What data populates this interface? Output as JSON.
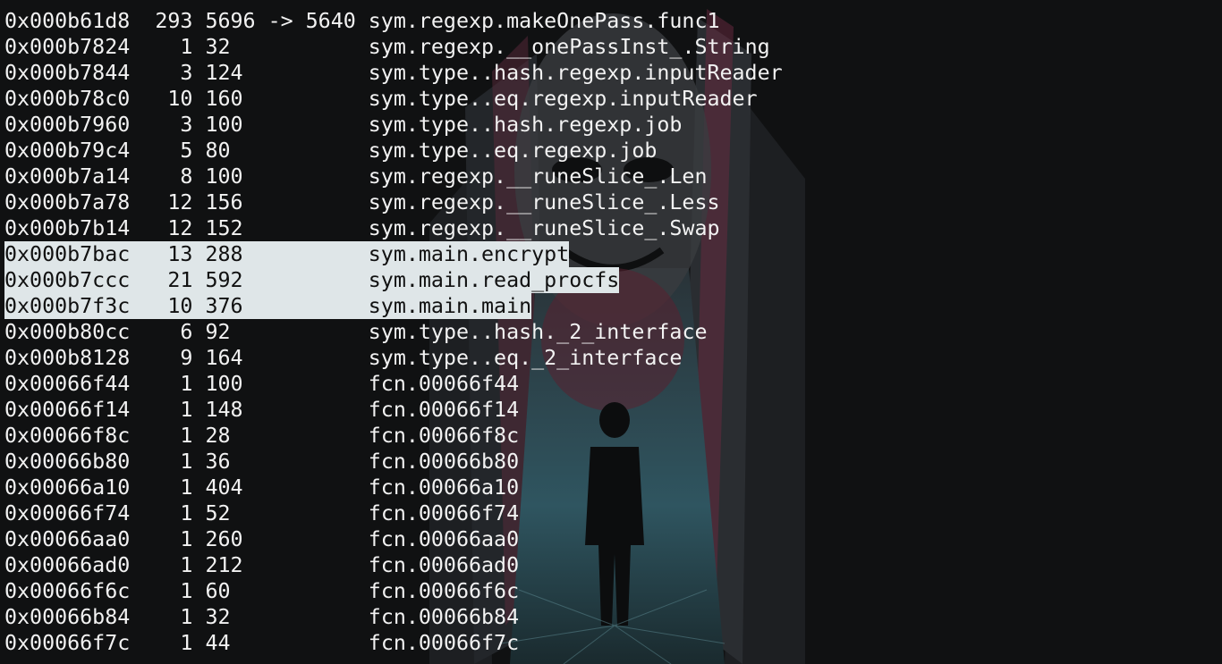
{
  "terminal": {
    "rows": [
      {
        "addr": "0x000b61d8",
        "nbbs": "293",
        "size": "5696 -> 5640",
        "name": "sym.regexp.makeOnePass.func1",
        "selected": false
      },
      {
        "addr": "0x000b7824",
        "nbbs": "1",
        "size": "32",
        "name": "sym.regexp.__onePassInst_.String",
        "selected": false
      },
      {
        "addr": "0x000b7844",
        "nbbs": "3",
        "size": "124",
        "name": "sym.type..hash.regexp.inputReader",
        "selected": false
      },
      {
        "addr": "0x000b78c0",
        "nbbs": "10",
        "size": "160",
        "name": "sym.type..eq.regexp.inputReader",
        "selected": false
      },
      {
        "addr": "0x000b7960",
        "nbbs": "3",
        "size": "100",
        "name": "sym.type..hash.regexp.job",
        "selected": false
      },
      {
        "addr": "0x000b79c4",
        "nbbs": "5",
        "size": "80",
        "name": "sym.type..eq.regexp.job",
        "selected": false
      },
      {
        "addr": "0x000b7a14",
        "nbbs": "8",
        "size": "100",
        "name": "sym.regexp.__runeSlice_.Len",
        "selected": false
      },
      {
        "addr": "0x000b7a78",
        "nbbs": "12",
        "size": "156",
        "name": "sym.regexp.__runeSlice_.Less",
        "selected": false
      },
      {
        "addr": "0x000b7b14",
        "nbbs": "12",
        "size": "152",
        "name": "sym.regexp.__runeSlice_.Swap",
        "selected": false
      },
      {
        "addr": "0x000b7bac",
        "nbbs": "13",
        "size": "288",
        "name": "sym.main.encrypt",
        "selected": true
      },
      {
        "addr": "0x000b7ccc",
        "nbbs": "21",
        "size": "592",
        "name": "sym.main.read_procfs",
        "selected": true
      },
      {
        "addr": "0x000b7f3c",
        "nbbs": "10",
        "size": "376",
        "name": "sym.main.main",
        "selected": true
      },
      {
        "addr": "0x000b80cc",
        "nbbs": "6",
        "size": "92",
        "name": "sym.type..hash._2_interface",
        "selected": false
      },
      {
        "addr": "0x000b8128",
        "nbbs": "9",
        "size": "164",
        "name": "sym.type..eq._2_interface",
        "selected": false
      },
      {
        "addr": "0x00066f44",
        "nbbs": "1",
        "size": "100",
        "name": "fcn.00066f44",
        "selected": false
      },
      {
        "addr": "0x00066f14",
        "nbbs": "1",
        "size": "148",
        "name": "fcn.00066f14",
        "selected": false
      },
      {
        "addr": "0x00066f8c",
        "nbbs": "1",
        "size": "28",
        "name": "fcn.00066f8c",
        "selected": false
      },
      {
        "addr": "0x00066b80",
        "nbbs": "1",
        "size": "36",
        "name": "fcn.00066b80",
        "selected": false
      },
      {
        "addr": "0x00066a10",
        "nbbs": "1",
        "size": "404",
        "name": "fcn.00066a10",
        "selected": false
      },
      {
        "addr": "0x00066f74",
        "nbbs": "1",
        "size": "52",
        "name": "fcn.00066f74",
        "selected": false
      },
      {
        "addr": "0x00066aa0",
        "nbbs": "1",
        "size": "260",
        "name": "fcn.00066aa0",
        "selected": false
      },
      {
        "addr": "0x00066ad0",
        "nbbs": "1",
        "size": "212",
        "name": "fcn.00066ad0",
        "selected": false
      },
      {
        "addr": "0x00066f6c",
        "nbbs": "1",
        "size": "60",
        "name": "fcn.00066f6c",
        "selected": false
      },
      {
        "addr": "0x00066b84",
        "nbbs": "1",
        "size": "32",
        "name": "fcn.00066b84",
        "selected": false
      },
      {
        "addr": "0x00066f7c",
        "nbbs": "1",
        "size": "44",
        "name": "fcn.00066f7c",
        "selected": false
      }
    ],
    "colors": {
      "background": "#101112",
      "foreground": "#f2f2f2",
      "selection": "#dfe6e8"
    },
    "wallpaper_icon": "hooded-figure-mask-wallpaper"
  }
}
